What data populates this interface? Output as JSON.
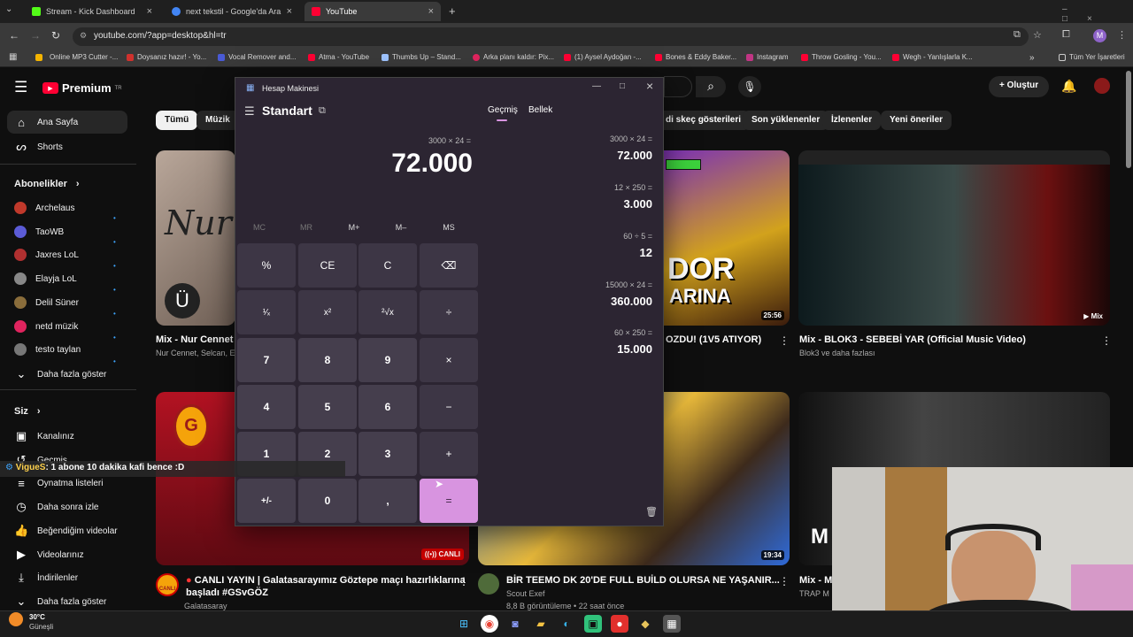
{
  "browser": {
    "tabs": [
      {
        "title": "Stream - Kick Dashboard",
        "color": "#53fc18"
      },
      {
        "title": "next tekstil - Google'da Ara",
        "color": "#4285f4"
      },
      {
        "title": "YouTube",
        "color": "#ff0033"
      }
    ],
    "url": "youtube.com/?app=desktop&hl=tr",
    "bookmarks": [
      "Online MP3 Cutter -...",
      "Doysanız hazır! - Yo...",
      "Vocal Remover and...",
      "Atma - YouTube",
      "Thumbs Up – Stand...",
      "Arka planı kaldır: Pix...",
      "(1) Aysel Aydoğan -...",
      "Bones & Eddy Baker...",
      "Instagram",
      "Throw Gosling - You...",
      "Wegh - Yanlışlarla K..."
    ],
    "all_bookmarks": "Tüm Yer İşaretleri",
    "profile": "M"
  },
  "youtube": {
    "logo": "Premium",
    "region": "TR",
    "create": "Oluştur",
    "sidebar": {
      "home": "Ana Sayfa",
      "shorts": "Shorts",
      "subs_header": "Abonelikler",
      "subs": [
        {
          "name": "Archelaus",
          "color": "#c0392b"
        },
        {
          "name": "TaoWB",
          "color": "#5b5bd6"
        },
        {
          "name": "Jaxres LoL",
          "color": "#b03030"
        },
        {
          "name": "Elayja LoL",
          "color": "#888"
        },
        {
          "name": "Delil Süner",
          "color": "#8a6d3b"
        },
        {
          "name": "netd müzik",
          "color": "#e0245e"
        },
        {
          "name": "testo taylan",
          "color": "#777"
        }
      ],
      "show_more": "Daha fazla göster",
      "you": "Siz",
      "you_items": [
        "Kanalınız",
        "Geçmiş",
        "Oynatma listeleri",
        "Daha sonra izle",
        "Beğendiğim videolar",
        "Videolarınız",
        "İndirilenler"
      ],
      "show_more2": "Daha fazla göster"
    },
    "chips": [
      "Tümü",
      "Müzik",
      "di skeç gösterileri",
      "Son yüklenenler",
      "İzlenenler",
      "Yeni öneriler"
    ],
    "videos": [
      {
        "title": "Mix - Nur Cennet -",
        "sub": "Nur Cennet, Selcan, E"
      },
      {
        "title": "OZDU! (1V5 ATIYOR)",
        "duration": "25:56"
      },
      {
        "title": "Mix - BLOK3 - SEBEBİ YAR (Official Music Video)",
        "sub": "Blok3 ve daha fazlası",
        "badge": "Mix"
      },
      {
        "title": "CANLI YAYIN | Galatasarayımız Göztepe maçı hazırlıklarına",
        "title2": "başladı #GSvGÖZ",
        "sub": "Galatasaray",
        "badge": "CANLI",
        "avatar_label": "CANLI"
      },
      {
        "title": "BİR TEEMO DK 20'DE FULL BUİLD OLURSA NE YAŞANIR...",
        "sub": "Scout Exef",
        "sub2": "8,8 B görüntüleme • 22 saat önce",
        "duration": "19:34"
      },
      {
        "title": "Mix - M",
        "sub": "TRAP M"
      }
    ],
    "thumb_texts": {
      "nur": "Nur",
      "dor": "DOR",
      "arina": "ARINA",
      "m": "M"
    }
  },
  "calculator": {
    "window_title": "Hesap Makinesi",
    "mode": "Standart",
    "tab_history": "Geçmiş",
    "tab_memory": "Bellek",
    "expression": "3000 × 24 =",
    "display": "72.000",
    "memory": [
      {
        "label": "MC",
        "enabled": false
      },
      {
        "label": "MR",
        "enabled": false
      },
      {
        "label": "M+",
        "enabled": true
      },
      {
        "label": "M–",
        "enabled": true
      },
      {
        "label": "MS",
        "enabled": true
      }
    ],
    "keys": [
      [
        "%",
        "CE",
        "C",
        "⌫"
      ],
      [
        "¹⁄ₓ",
        "x²",
        "²√x",
        "÷"
      ],
      [
        "7",
        "8",
        "9",
        "×"
      ],
      [
        "4",
        "5",
        "6",
        "−"
      ],
      [
        "1",
        "2",
        "3",
        "+"
      ],
      [
        "+/-",
        "0",
        ",",
        "="
      ]
    ],
    "history": [
      {
        "expr": "3000 × 24 =",
        "result": "72.000"
      },
      {
        "expr": "12 × 250 =",
        "result": "3.000"
      },
      {
        "expr": "60 ÷ 5 =",
        "result": "12"
      },
      {
        "expr": "15000 × 24 =",
        "result": "360.000"
      },
      {
        "expr": "60 × 250 =",
        "result": "15.000"
      }
    ]
  },
  "chat": {
    "user": "VigueS",
    "message": ": 1 abone 10 dakika kafi bence :D"
  },
  "taskbar": {
    "temp": "30°C",
    "weather": "Güneşli"
  }
}
